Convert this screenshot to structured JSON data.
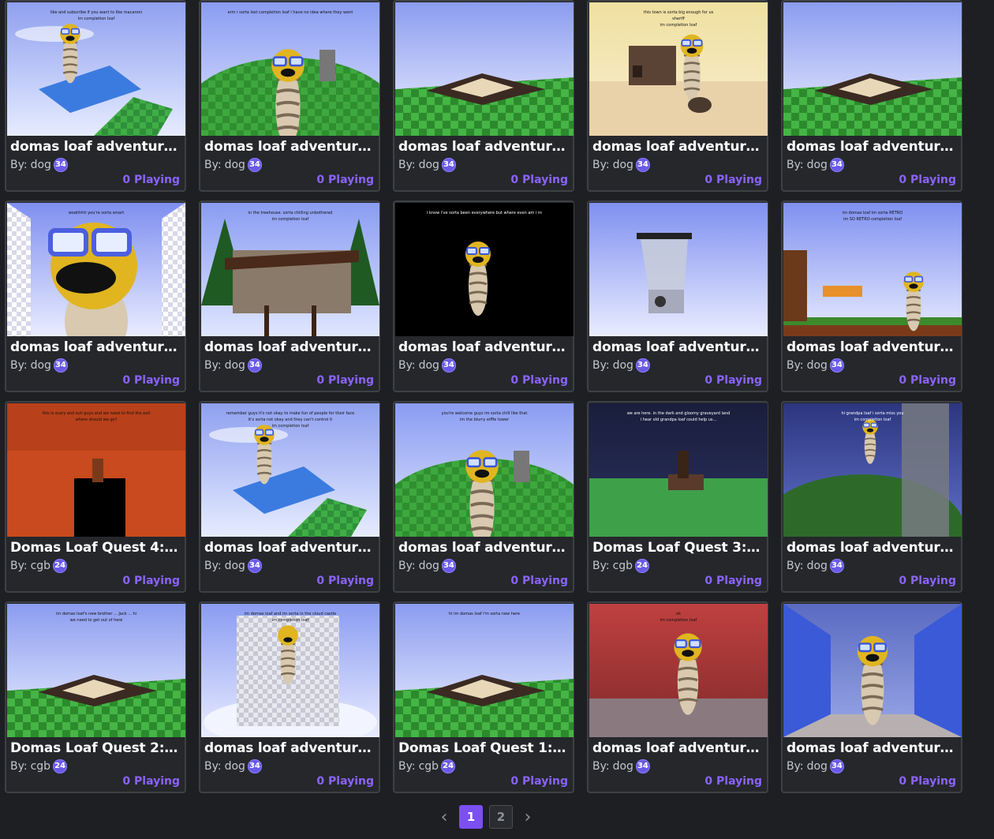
{
  "games": [
    {
      "title": "domas loaf adventure...",
      "author": "dog",
      "level": "34",
      "playing": "0 Playing",
      "scene": "sky",
      "texts": [
        "like and subscribe if you want to like macaroni",
        "im completion loaf"
      ]
    },
    {
      "title": "domas loaf adventure...",
      "author": "dog",
      "level": "34",
      "playing": "0 Playing",
      "scene": "island",
      "texts": [
        "erm i sorta lost completion loaf i have no idea where they went"
      ]
    },
    {
      "title": "domas loaf adventure...",
      "author": "dog",
      "level": "34",
      "playing": "0 Playing",
      "scene": "checker",
      "texts": []
    },
    {
      "title": "domas loaf adventure...",
      "author": "dog",
      "level": "34",
      "playing": "0 Playing",
      "scene": "desert",
      "texts": [
        "this town is sorta big enough for us",
        "sheriff",
        "im completion loaf"
      ]
    },
    {
      "title": "domas loaf adventure...",
      "author": "dog",
      "level": "34",
      "playing": "0 Playing",
      "scene": "checker",
      "texts": []
    },
    {
      "title": "domas loaf adventure...",
      "author": "dog",
      "level": "34",
      "playing": "0 Playing",
      "scene": "closeup",
      "texts": [
        "woahhhh you're sorta smart"
      ]
    },
    {
      "title": "domas loaf adventure...",
      "author": "dog",
      "level": "34",
      "playing": "0 Playing",
      "scene": "forest",
      "texts": [
        "in the treehouse. sorta chilling unbothered",
        "im completion loaf"
      ]
    },
    {
      "title": "domas loaf adventure...",
      "author": "dog",
      "level": "34",
      "playing": "0 Playing",
      "scene": "dark",
      "texts": [
        "i know i've sorta been everywhere but where even am i rn"
      ]
    },
    {
      "title": "domas loaf adventure...",
      "author": "dog",
      "level": "34",
      "playing": "0 Playing",
      "scene": "blender",
      "texts": []
    },
    {
      "title": "domas loaf adventure...",
      "author": "dog",
      "level": "34",
      "playing": "0 Playing",
      "scene": "retro",
      "texts": [
        "im domas loaf im sorta RETRO",
        "im SO RETRO completion loaf"
      ]
    },
    {
      "title": "Domas Loaf Quest 4: E...",
      "author": "cgb",
      "level": "24",
      "playing": "0 Playing",
      "scene": "lava",
      "texts": [
        "this is scary and evil guys and we need to find the exit",
        "where should we go?"
      ]
    },
    {
      "title": "domas loaf adventure...",
      "author": "dog",
      "level": "34",
      "playing": "0 Playing",
      "scene": "sky",
      "texts": [
        "remember guys it's not okay to make fun of people for their face",
        "it's sorta not okay and they can't control it",
        "im completion loaf"
      ]
    },
    {
      "title": "domas loaf adventure...",
      "author": "dog",
      "level": "34",
      "playing": "0 Playing",
      "scene": "island",
      "texts": [
        "you're welcome guys im sorta chill like that",
        "im the blurry eiffle tower"
      ]
    },
    {
      "title": "Domas Loaf Quest 3: ...",
      "author": "cgb",
      "level": "24",
      "playing": "0 Playing",
      "scene": "graveyard",
      "texts": [
        "we are here. in the dark and gloomy graveyard land",
        "i hear old grandpa loaf could help us..."
      ]
    },
    {
      "title": "domas loaf adventure...",
      "author": "dog",
      "level": "34",
      "playing": "0 Playing",
      "scene": "night",
      "texts": [
        "hi grandpa loaf i sorta miss you",
        "im completion loaf"
      ]
    },
    {
      "title": "Domas Loaf Quest 2: ...",
      "author": "cgb",
      "level": "24",
      "playing": "0 Playing",
      "scene": "checker",
      "texts": [
        "im domas loaf's new brother ... Jack ... hi",
        "we need to get out of here"
      ]
    },
    {
      "title": "domas loaf adventure...",
      "author": "dog",
      "level": "34",
      "playing": "0 Playing",
      "scene": "castle",
      "texts": [
        "im domas loaf and im sorta in the cloud castle",
        "im completion loaf"
      ]
    },
    {
      "title": "Domas Loaf Quest 1: t...",
      "author": "cgb",
      "level": "24",
      "playing": "0 Playing",
      "scene": "checker",
      "texts": [
        "hi im domas loaf i'm sorta new here"
      ]
    },
    {
      "title": "domas loaf adventure...",
      "author": "dog",
      "level": "34",
      "playing": "0 Playing",
      "scene": "redroom",
      "texts": [
        "ok",
        "im completion loaf"
      ]
    },
    {
      "title": "domas loaf adventure...",
      "author": "dog",
      "level": "34",
      "playing": "0 Playing",
      "scene": "hall",
      "texts": []
    }
  ],
  "pagination": {
    "prev_icon": "chevron-left-icon",
    "next_icon": "chevron-right-icon",
    "pages": [
      "1",
      "2"
    ],
    "current": "1"
  },
  "colors": {
    "background": "#1e1f22",
    "card": "#25272b",
    "accent": "#7b4ff2",
    "playing": "#8a63ff",
    "level_badge": "#6a5ae6"
  }
}
